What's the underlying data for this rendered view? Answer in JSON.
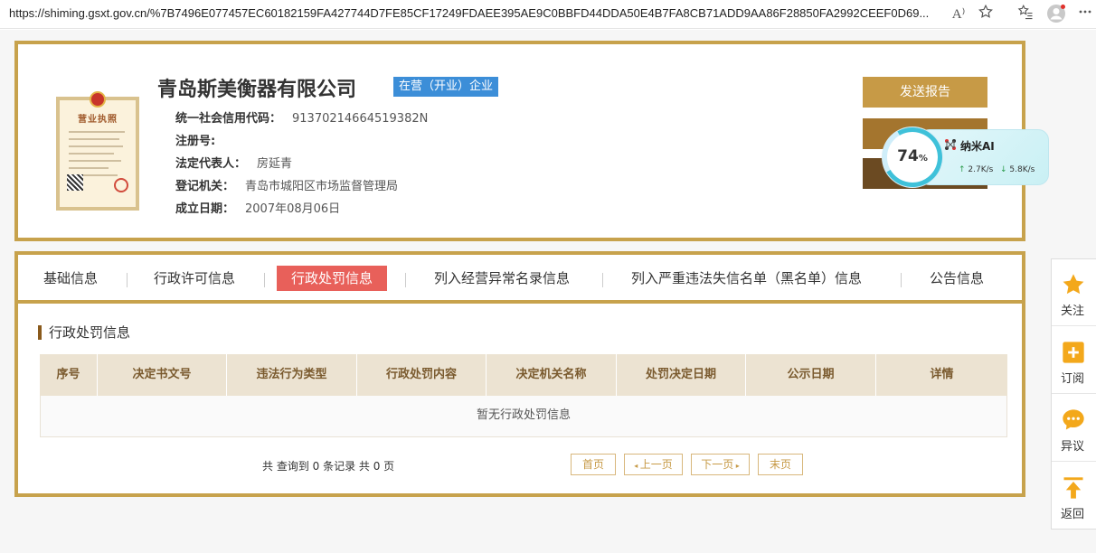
{
  "browser": {
    "url": "https://shiming.gsxt.gov.cn/%7B7496E077457EC60182159FA427744D7FE85CF17249FDAEE395AE9C0BBFD44DDA50E4B7FA8CB71ADD9AA86F28850FA2992CEEF0D69...",
    "read_aloud_label": "A⁾",
    "icons": [
      "read-aloud-icon",
      "favorite-star-icon",
      "favorites-list-icon",
      "profile-avatar-icon",
      "more-menu-icon"
    ]
  },
  "license_image": {
    "title": "营业执照"
  },
  "company": {
    "name": "青岛斯美衡器有限公司",
    "status": "在营（开业）企业",
    "fields": [
      {
        "key": "统一社会信用代码：",
        "value": "91370214664519382N"
      },
      {
        "key": "注册号:",
        "value": ""
      },
      {
        "key": "法定代表人：",
        "value": "房延青"
      },
      {
        "key": "登记机关：",
        "value": "青岛市城阳区市场监督管理局"
      },
      {
        "key": "成立日期：",
        "value": "2007年08月06日"
      }
    ],
    "actions": {
      "send_report": "发送报告"
    }
  },
  "ai_widget": {
    "percent": "74",
    "percent_unit": "%",
    "name": "纳米AI",
    "upload": "2.7K/s",
    "download": "5.8K/s",
    "accent": "#3fc1d9"
  },
  "tabs": [
    {
      "label": "基础信息",
      "active": false
    },
    {
      "label": "行政许可信息",
      "active": false
    },
    {
      "label": "行政处罚信息",
      "active": true
    },
    {
      "label": "列入经营异常名录信息",
      "active": false
    },
    {
      "label": "列入严重违法失信名单（黑名单）信息",
      "active": false
    },
    {
      "label": "公告信息",
      "active": false
    }
  ],
  "section": {
    "title": "行政处罚信息",
    "columns": [
      "序号",
      "决定书文号",
      "违法行为类型",
      "行政处罚内容",
      "决定机关名称",
      "处罚决定日期",
      "公示日期",
      "详情"
    ],
    "empty_text": "暂无行政处罚信息",
    "summary": "共 查询到 0 条记录 共 0 页",
    "pagination": {
      "first": "首页",
      "prev": "上一页",
      "next": "下一页",
      "last": "末页"
    }
  },
  "float_panel": [
    {
      "label": "关注",
      "icon": "star-icon"
    },
    {
      "label": "订阅",
      "icon": "subscribe-plus-icon"
    },
    {
      "label": "异议",
      "icon": "objection-chat-icon"
    },
    {
      "label": "返回",
      "icon": "back-to-top-icon"
    }
  ],
  "colors": {
    "gold_border": "#c7a24c",
    "active_tab": "#e8605a",
    "status_badge": "#3c8ed8",
    "table_header": "#ece3d2"
  }
}
